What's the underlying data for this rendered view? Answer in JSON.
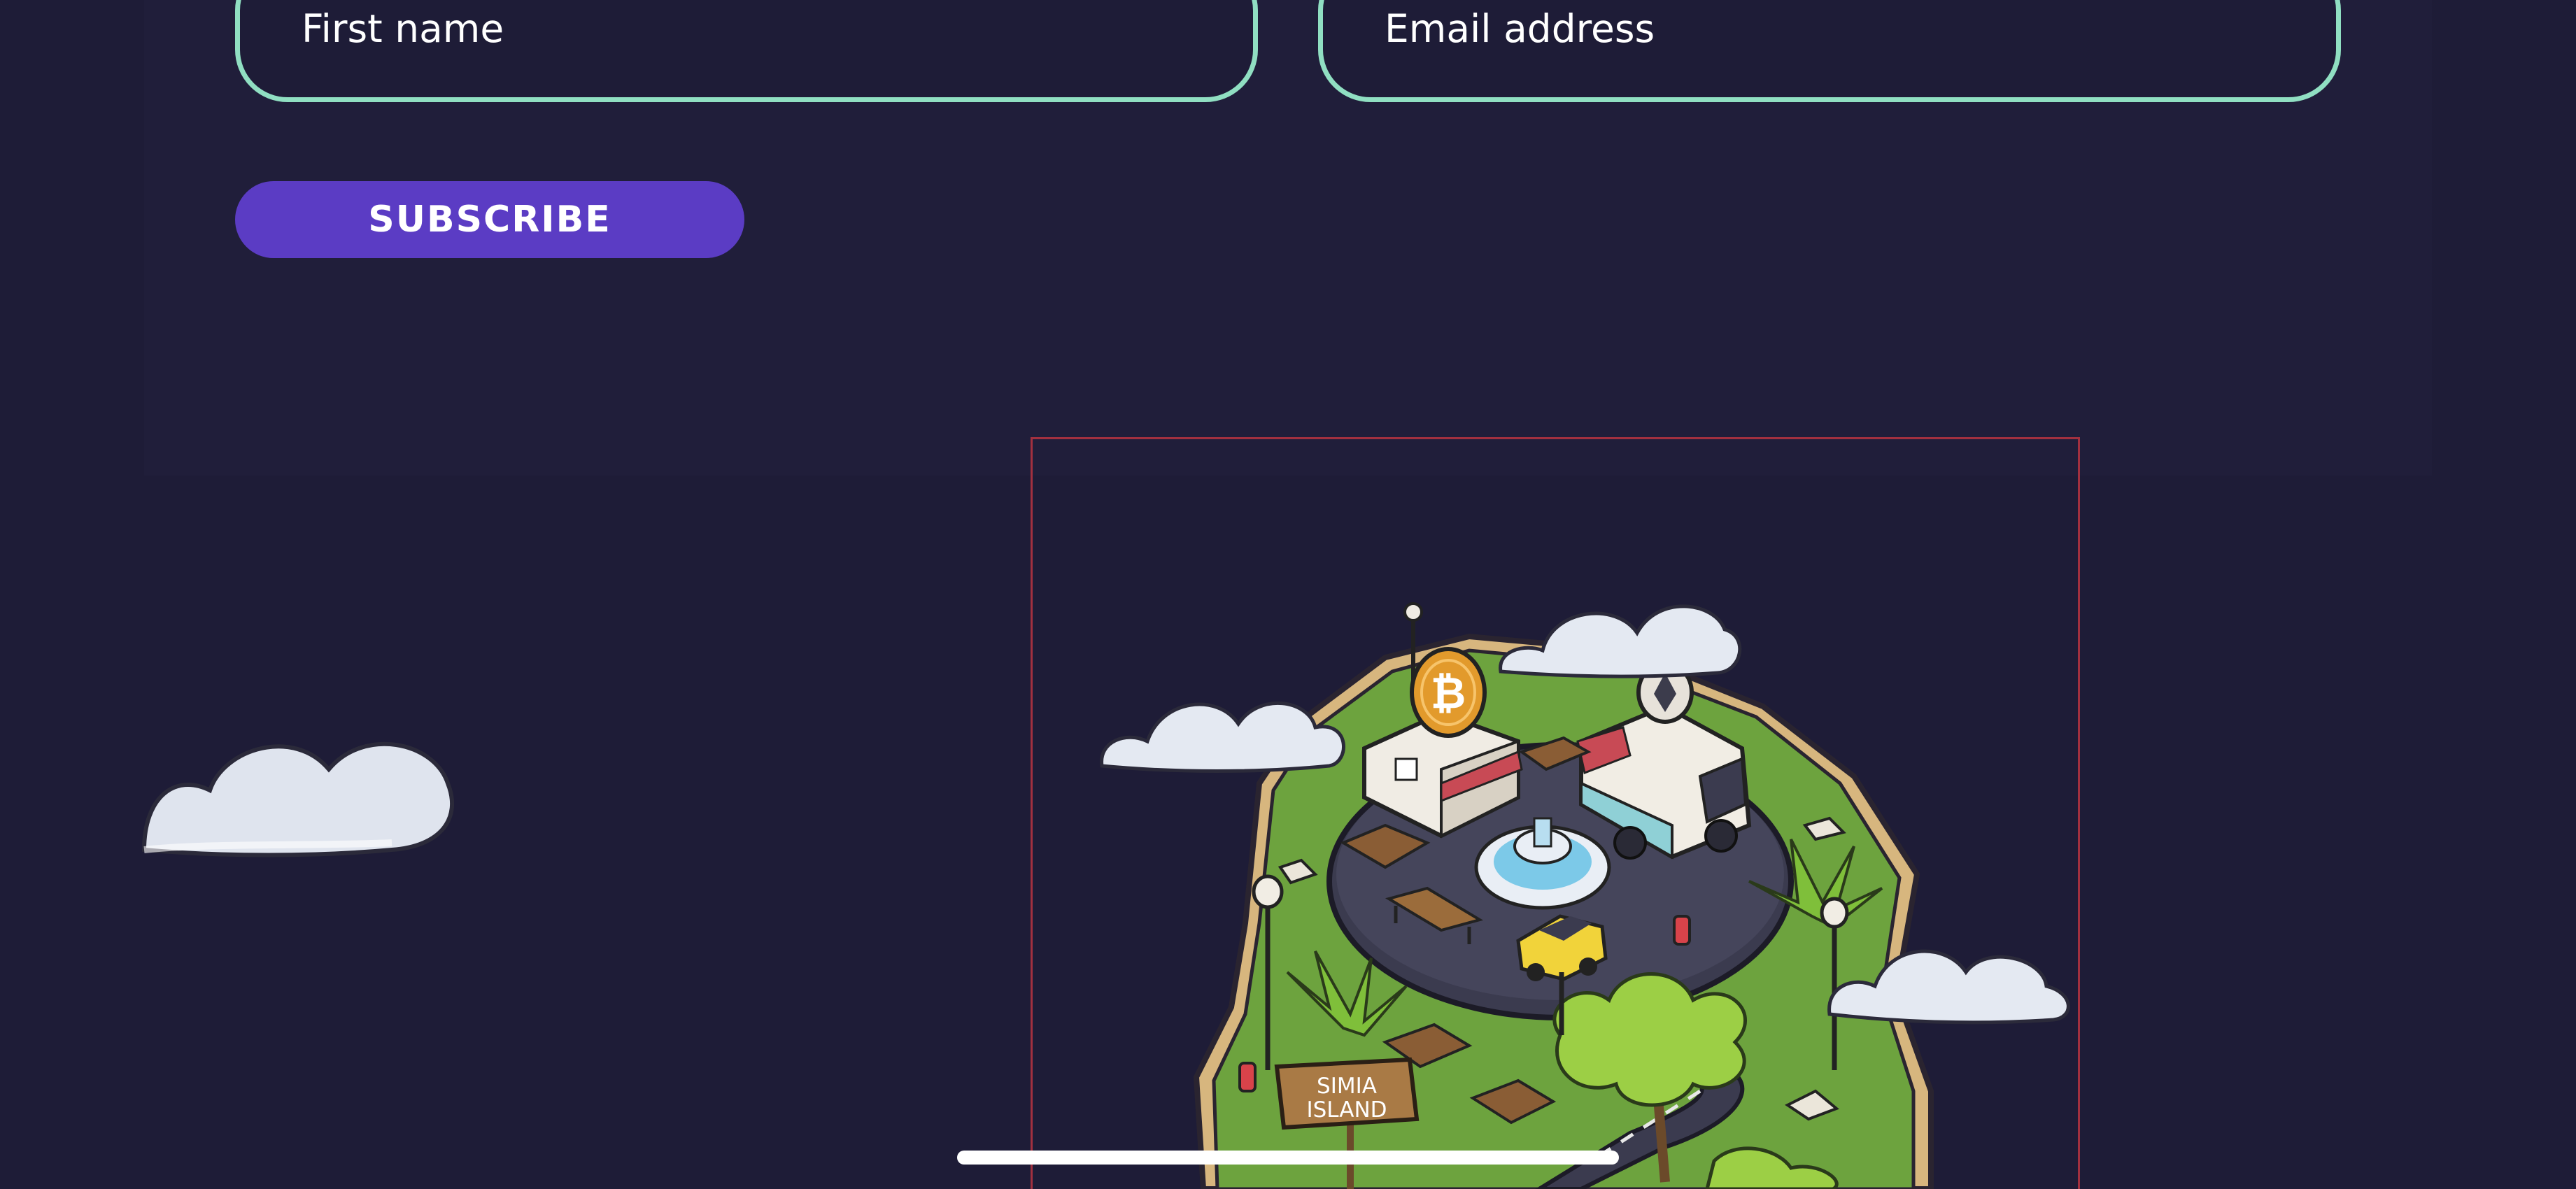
{
  "form": {
    "first_name_placeholder": "First name",
    "email_placeholder": "Email address",
    "subscribe_label": "SUBSCRIBE"
  },
  "illustration": {
    "sign_line1": "SIMIA",
    "sign_line2": "ISLAND",
    "coin_symbol": "₿"
  },
  "colors": {
    "background": "#1e1c37",
    "field_border": "#90dfc2",
    "button": "#5b3cc4",
    "frame_outline": "#a2303f"
  }
}
